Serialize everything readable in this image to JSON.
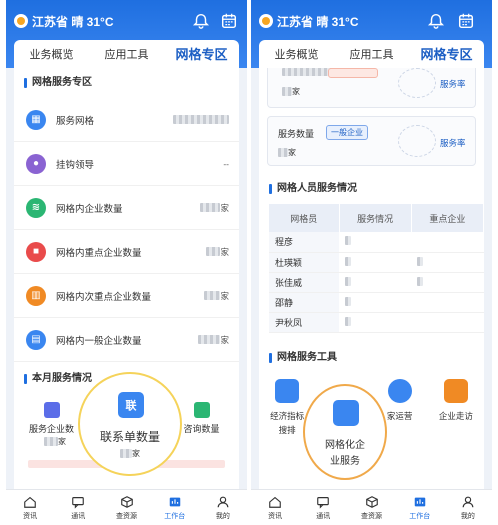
{
  "weather": {
    "text": "江苏省 晴 31°C"
  },
  "left": {
    "tabs": [
      "业务概览",
      "应用工具",
      "网格专区"
    ],
    "section_grid": "网格服务专区",
    "rows": [
      {
        "label": "服务网格",
        "value": "",
        "unit": ""
      },
      {
        "label": "挂钩领导",
        "value": "--",
        "unit": ""
      },
      {
        "label": "网格内企业数量",
        "value": "",
        "unit": "家"
      },
      {
        "label": "网格内重点企业数量",
        "value": "",
        "unit": "家"
      },
      {
        "label": "网格内次重点企业数量",
        "value": "",
        "unit": "家"
      },
      {
        "label": "网格内一般企业数量",
        "value": "",
        "unit": "家"
      }
    ],
    "section_month": "本月服务情况",
    "month_items": [
      {
        "label": "服务企业数",
        "unit": "家"
      },
      {
        "label": "联系单数量",
        "unit": "家"
      },
      {
        "label": "咨询数量",
        "unit": ""
      }
    ],
    "highlight": {
      "icon_text": "联",
      "label": "联系单数量",
      "unit": "家"
    }
  },
  "right": {
    "tabs": [
      "业务概览",
      "应用工具",
      "网格专区"
    ],
    "card1": {
      "rate_label": "服务率",
      "unit": "家"
    },
    "card2": {
      "label": "服务数量",
      "tag": "一般企业",
      "rate_label": "服务率",
      "unit": "家"
    },
    "section_people": "网格人员服务情况",
    "table": {
      "headers": [
        "网格员",
        "服务情况",
        "重点企业"
      ],
      "rows": [
        "程彦",
        "杜瑛颖",
        "张佳威",
        "邵静",
        "尹秋凤"
      ]
    },
    "section_tools": "网格服务工具",
    "tools": [
      {
        "label": "经济指标",
        "label2": "搜排"
      },
      {
        "label": "网格化企",
        "label2": "业服务"
      },
      {
        "label": "家运营",
        "label2": ""
      },
      {
        "label": "企业走访",
        "label2": ""
      }
    ],
    "highlight": {
      "label": "网格化企",
      "label2": "业服务"
    }
  },
  "nav": [
    "资讯",
    "通讯",
    "查资源",
    "工作台",
    "我的"
  ],
  "colors": {
    "primary": "#1f6fe0",
    "highlight_left": "#f5d35a",
    "highlight_right": "#f0a94a"
  }
}
